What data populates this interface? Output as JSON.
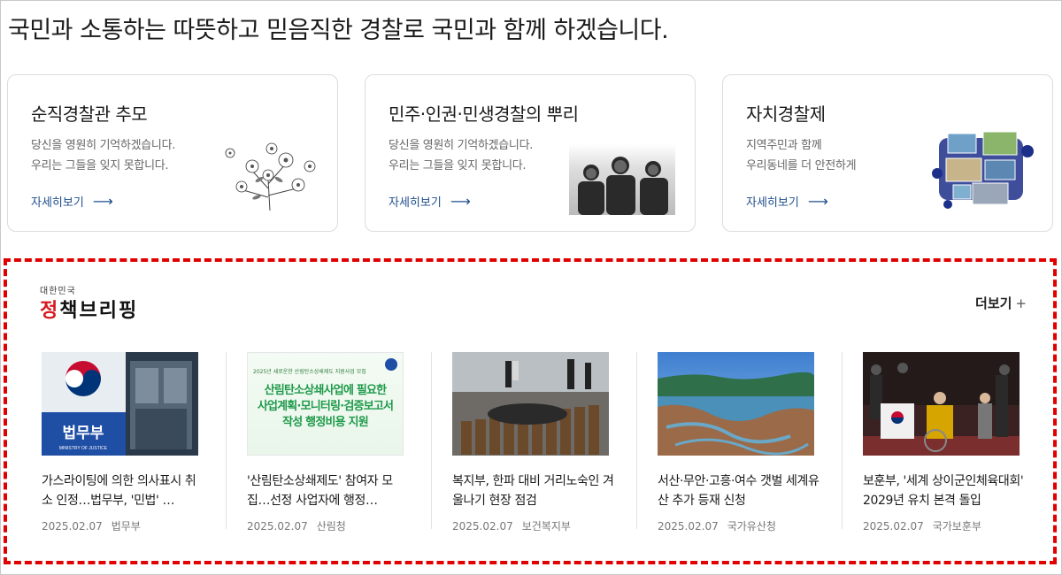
{
  "slogan": "국민과 소통하는 따뜻하고 믿음직한 경찰로 국민과 함께 하겠습니다.",
  "cards": [
    {
      "title": "순직경찰관 추모",
      "desc1": "당신을 영원히 기억하겠습니다.",
      "desc2": "우리는 그들을 잊지 못합니다.",
      "more": "자세히보기",
      "image": "flower-illustration"
    },
    {
      "title": "민주·인권·민생경찰의 뿌리",
      "desc1": "당신을 영원히 기억하겠습니다.",
      "desc2": "우리는 그들을 잊지 못합니다.",
      "more": "자세히보기",
      "image": "historic-portrait-photo"
    },
    {
      "title": "자치경찰제",
      "desc1": "지역주민과 함께",
      "desc2": "우리동네를 더 안전하게",
      "more": "자세히보기",
      "image": "town-collage-illustration"
    }
  ],
  "briefing": {
    "brand_small": "대한민국",
    "brand_main": "정책브리핑",
    "more": "더보기",
    "more_icon": "+",
    "items": [
      {
        "title": "가스라이팅에 의한 의사표시 취소 인정…법무부, '민법' …",
        "date": "2025.02.07",
        "source": "법무부",
        "thumb": "ministry-of-justice-building"
      },
      {
        "title": "'산림탄소상쇄제도' 참여자 모집…선정 사업자에 행정…",
        "date": "2025.02.07",
        "source": "산림청",
        "thumb": "green-banner",
        "thumb_line1": "산림탄소상쇄사업에 필요한",
        "thumb_line2": "사업계획·모니터링·검증보고서",
        "thumb_line3": "작성 행정비용 지원",
        "thumb_top": "2025년 새로운한 산림탄소상쇄제도 지원사업 모집"
      },
      {
        "title": "복지부, 한파 대비 거리노숙인 겨울나기 현장 점검",
        "date": "2025.02.07",
        "source": "보건복지부",
        "thumb": "street-winter-photo"
      },
      {
        "title": "서산·무안·고흥·여수 갯벌 세계유산 추가 등재 신청",
        "date": "2025.02.07",
        "source": "국가유산청",
        "thumb": "tidal-flat-aerial-photo"
      },
      {
        "title": "보훈부, '세계 상이군인체육대회' 2029년 유치 본격 돌입",
        "date": "2025.02.07",
        "source": "국가보훈부",
        "thumb": "ceremony-stage-photo"
      }
    ]
  },
  "colors": {
    "accent_red": "#d71920",
    "link_blue": "#1f4e8c",
    "dashed_border": "#e00000",
    "banner_green": "#1e9a4a"
  }
}
